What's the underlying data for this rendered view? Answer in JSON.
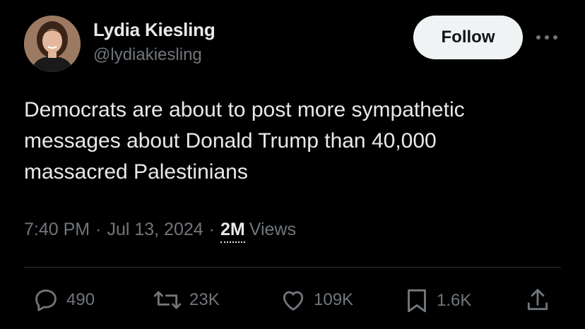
{
  "author": {
    "display_name": "Lydia Kiesling",
    "handle": "@lydiakiesling",
    "avatar_icon": "profile-photo"
  },
  "follow_button": {
    "label": "Follow"
  },
  "more_icon": "more-horizontal-icon",
  "tweet": {
    "text": "Democrats are about to post more sympathetic\nmessages about Donald Trump than 40,000\nmassacred Palestinians"
  },
  "meta": {
    "time": "7:40 PM",
    "date": "Jul 13, 2024",
    "separator": "·",
    "views_count": "2M",
    "views_label": "Views"
  },
  "actions": {
    "reply": {
      "icon": "reply-icon",
      "count": "490"
    },
    "repost": {
      "icon": "repost-icon",
      "count": "23K"
    },
    "like": {
      "icon": "heart-icon",
      "count": "109K"
    },
    "bookmark": {
      "icon": "bookmark-icon",
      "count": "1.6K"
    },
    "share": {
      "icon": "share-icon"
    }
  },
  "colors": {
    "background": "#000000",
    "primary_text": "#e7e9ea",
    "secondary_text": "#71767b",
    "follow_bg": "#eff3f4",
    "divider": "#2f3336"
  }
}
